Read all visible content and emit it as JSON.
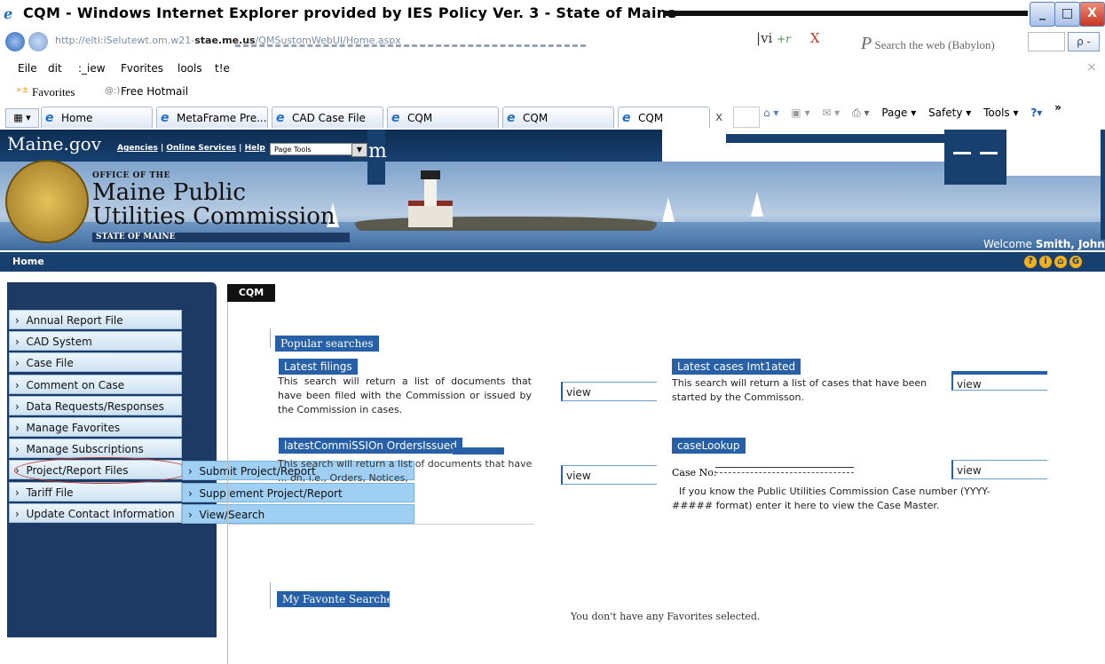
{
  "window": {
    "title": "CQM - Windows Internet Explorer provided by IES Policy Ver. 3 - State of Maine",
    "minimize": "_",
    "restore": "□",
    "close": "X"
  },
  "address": {
    "url_faded": "http://elti:iSelutewt.om.w21-",
    "url_host": "stae.me.us",
    "url_rest": "/QMSustomWebUI/Home.aspx",
    "extra_text": "vi",
    "extra_plus": "+r",
    "extra_x": "X",
    "search_prefix": "P",
    "search_placeholder": "Search the web (Babylon)",
    "search_go": "ρ -"
  },
  "menu": {
    "items": [
      "Eile",
      "dit",
      ":_iew",
      "Fvorites",
      "lools",
      "t!e"
    ],
    "close": "×"
  },
  "favorites_bar": {
    "favorites": "Favorites",
    "hotmail": "Free Hotmail"
  },
  "tabs": [
    {
      "label": "Home"
    },
    {
      "label": "MetaFrame Pre..."
    },
    {
      "label": "CAD Case File"
    },
    {
      "label": "CQM"
    },
    {
      "label": "CQM"
    },
    {
      "label": "CQM"
    }
  ],
  "tab_close": "x",
  "commandbar": {
    "page": "Page ▾",
    "safety": "Safety ▾",
    "tools": "Tools ▾",
    "help": "?▾",
    "more": "»"
  },
  "site": {
    "brand": "Maine.gov",
    "links": [
      "Agencies",
      "Online Services",
      "Help"
    ],
    "page_tools": "Page Tools",
    "page_tools_btn": "▼",
    "m_letter": "m",
    "office_label": "OFFICE OF THE",
    "agency_line1": "Maine Public",
    "agency_line2": "Utilities Commission",
    "state_label": "STATE OF MAINE",
    "welcome_prefix": "Welcome",
    "welcome_user": "Smith, John",
    "home": "Home",
    "icons": [
      "?",
      "i",
      "⌂",
      "G"
    ]
  },
  "sidebar": {
    "items": [
      {
        "label": "Annual Report File"
      },
      {
        "label": "CAD System"
      },
      {
        "label": "Case File"
      },
      {
        "label": "Comment on Case"
      },
      {
        "label": "Data Requests/Responses"
      },
      {
        "label": "Manage Favorites"
      },
      {
        "label": "Manage Subscriptions"
      },
      {
        "label": "Project/Report Files"
      },
      {
        "label": "Tariff File"
      },
      {
        "label": "Update Contact Information"
      }
    ],
    "submenu": [
      {
        "label": "Submit Project/Report"
      },
      {
        "label": "Supplement Project/Report"
      },
      {
        "label": "View/Search"
      }
    ]
  },
  "content": {
    "tab": "CQM",
    "popular_searches": "Popular searches",
    "latest_filings": {
      "title": "Latest filings",
      "desc": "This search will return a list of documents that have been filed with the Commission or issued by the Commission in cases.",
      "view": "view"
    },
    "latest_cases": {
      "title": "Latest cases Imt1ated",
      "desc": "This search will return a list of cases that have been started by the Commisson.",
      "view": "view"
    },
    "latest_orders": {
      "title": "latestCommiSSIOn OrdersIssued",
      "desc": "This search will return a list of documents that have ... on, i.e., Orders, Notices,",
      "view": "view"
    },
    "case_lookup": {
      "title": "caseLookup",
      "case_no_label": "Case No:",
      "help": "If you know the Public Utilities Commission Case number (YYYY-##### format) enter it here to view the Case Master.",
      "view": "view"
    },
    "my_favorite_searches": "My Favonte Searches",
    "no_favorites": "You don't have any Favorites selected."
  }
}
